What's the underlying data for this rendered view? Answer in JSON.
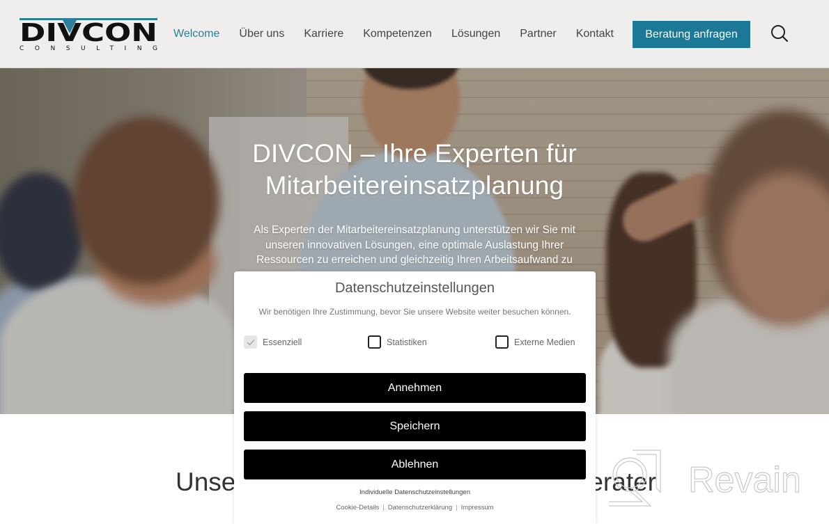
{
  "header": {
    "logo": {
      "main": "DIVCON",
      "sub": "CONSULTING",
      "accent_color": "#2b7f9a"
    },
    "nav": [
      {
        "label": "Welcome",
        "active": true
      },
      {
        "label": "Über uns",
        "active": false
      },
      {
        "label": "Karriere",
        "active": false
      },
      {
        "label": "Kompetenzen",
        "active": false
      },
      {
        "label": "Lösungen",
        "active": false
      },
      {
        "label": "Partner",
        "active": false
      },
      {
        "label": "Kontakt",
        "active": false
      }
    ],
    "cta_label": "Beratung anfragen",
    "cta_color": "#1b7896",
    "search_icon": "search-icon"
  },
  "hero": {
    "title_line1": "DIVCON – Ihre Experten für",
    "title_line2": "Mitarbeitereinsatzplanung",
    "text": "Als Experten der Mitarbeitereinsatzplanung unterstützen wir Sie mit unseren innovativen Lösungen, eine optimale Auslastung Ihrer Ressourcen zu erreichen und gleichzeitig Ihren Arbeitsaufwand zu"
  },
  "section": {
    "heading_left": "Unse",
    "heading_right": "erater"
  },
  "consent": {
    "title": "Datenschutzeinstellungen",
    "description": "Wir benötigen Ihre Zustimmung, bevor Sie unsere Website weiter besuchen können.",
    "options": [
      {
        "label": "Essenziell",
        "checked": true,
        "disabled": true
      },
      {
        "label": "Statistiken",
        "checked": false,
        "disabled": false
      },
      {
        "label": "Externe Medien",
        "checked": false,
        "disabled": false
      }
    ],
    "buttons": {
      "accept": "Annehmen",
      "save": "Speichern",
      "reject": "Ablehnen"
    },
    "individual_link": "Individuelle Datenschutzeinstellungen",
    "footer_links": [
      "Cookie-Details",
      "Datenschutzerklärung",
      "Impressum"
    ],
    "footer_separator": "|"
  },
  "watermark": {
    "text": "Revain"
  }
}
